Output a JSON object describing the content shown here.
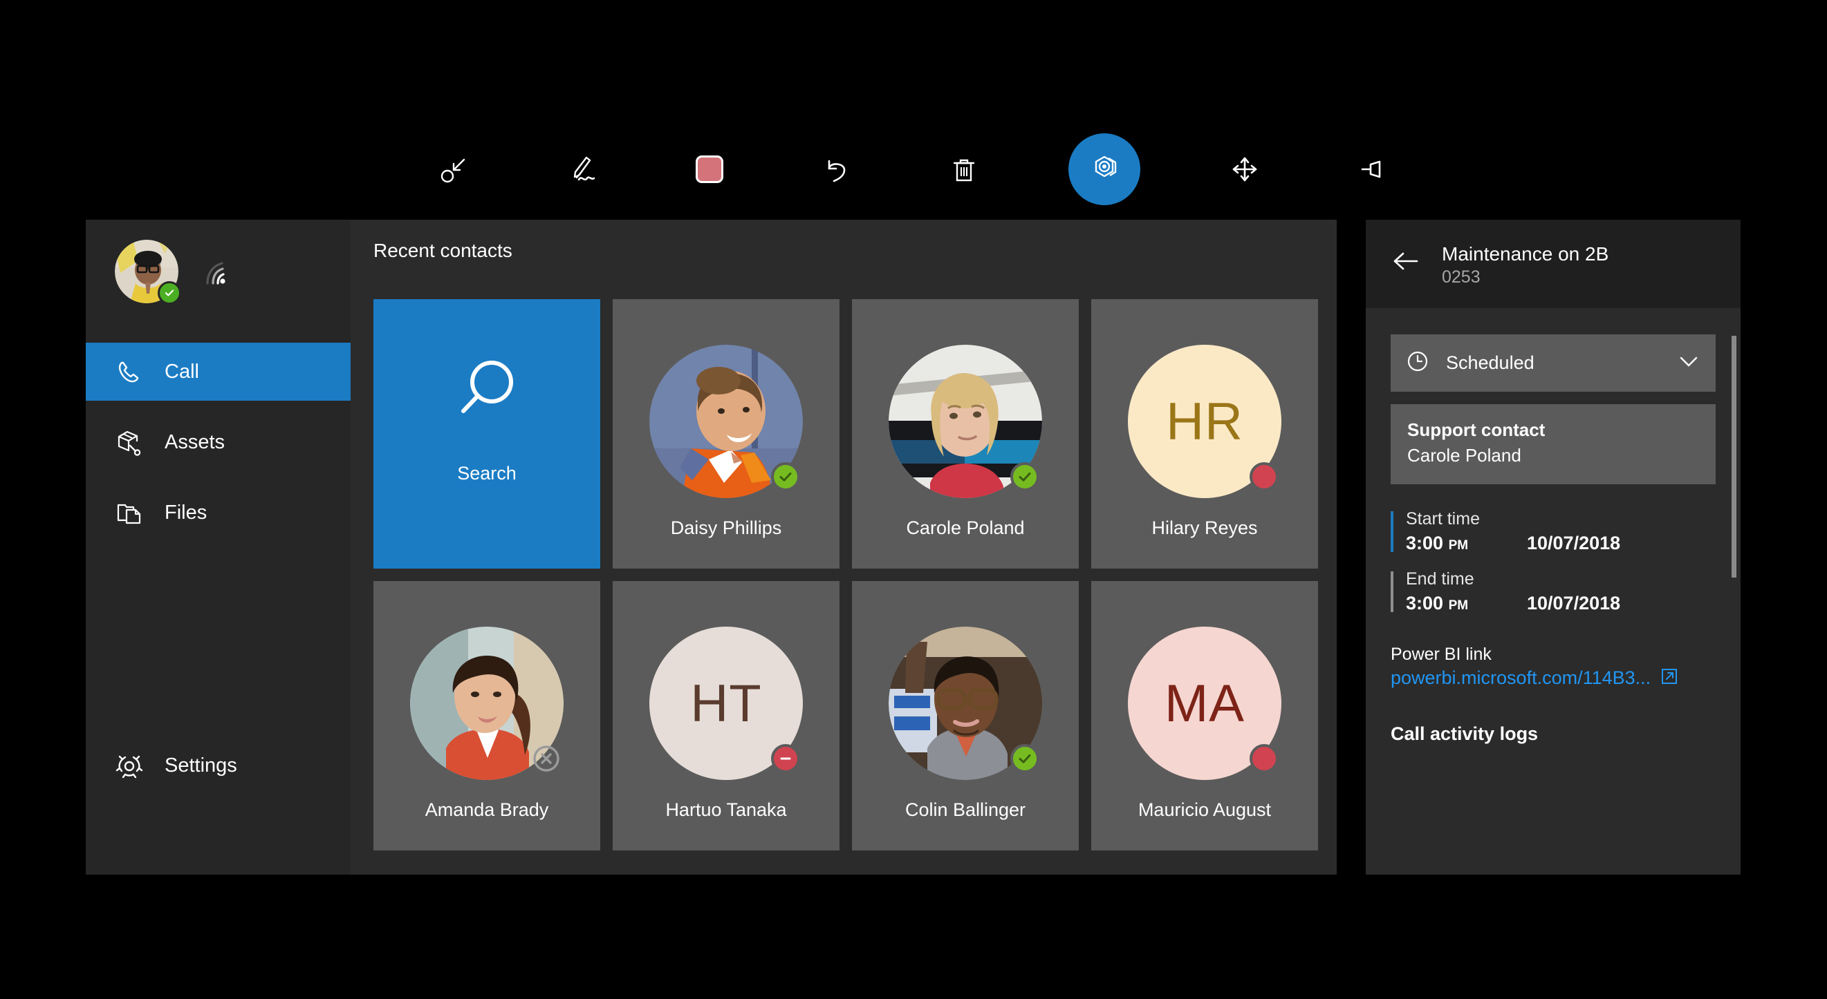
{
  "toolbar": {
    "items": [
      {
        "name": "collapse-icon",
        "label": "Collapse"
      },
      {
        "name": "ink-pen-icon",
        "label": "Ink"
      },
      {
        "name": "color-swatch-icon",
        "label": "Color",
        "color": "#d4737a"
      },
      {
        "name": "undo-icon",
        "label": "Undo"
      },
      {
        "name": "delete-icon",
        "label": "Delete"
      },
      {
        "name": "remote-assist-icon",
        "label": "Remote Assist",
        "color": "#1b7cc4"
      },
      {
        "name": "move-icon",
        "label": "Move"
      },
      {
        "name": "pin-icon",
        "label": "Pin"
      }
    ]
  },
  "sidebar": {
    "user": {
      "presence": "available",
      "signal_icon": "signal-strength-icon"
    },
    "items": [
      {
        "id": "call",
        "label": "Call",
        "icon": "phone-icon",
        "active": true
      },
      {
        "id": "assets",
        "label": "Assets",
        "icon": "assets-box-wrench-icon",
        "active": false
      },
      {
        "id": "files",
        "label": "Files",
        "icon": "files-folder-icon",
        "active": false
      },
      {
        "id": "settings",
        "label": "Settings",
        "icon": "gear-icon",
        "active": false
      }
    ]
  },
  "main": {
    "title": "Recent contacts",
    "search_tile": {
      "label": "Search",
      "icon": "search-icon",
      "color": "#1b7cc4"
    },
    "contacts": [
      {
        "name": "Daisy Phillips",
        "avatar_type": "photo",
        "photo": "daisy",
        "presence": "available"
      },
      {
        "name": "Carole Poland",
        "avatar_type": "photo",
        "photo": "carole",
        "presence": "available"
      },
      {
        "name": "Hilary Reyes",
        "avatar_type": "initials",
        "initials": "HR",
        "bg": "#fbe9c6",
        "fg": "#9a7618",
        "presence": "busy"
      },
      {
        "name": "Amanda Brady",
        "avatar_type": "photo",
        "photo": "amanda",
        "presence": "offline"
      },
      {
        "name": "Hartuo Tanaka",
        "avatar_type": "initials",
        "initials": "HT",
        "bg": "#e6ddd8",
        "fg": "#5a3c2e",
        "presence": "away"
      },
      {
        "name": "Colin Ballinger",
        "avatar_type": "photo",
        "photo": "colin",
        "presence": "available"
      },
      {
        "name": "Mauricio August",
        "avatar_type": "initials",
        "initials": "MA",
        "bg": "#f5d6d0",
        "fg": "#7d2317",
        "presence": "busy"
      }
    ]
  },
  "detail": {
    "back_icon": "back-arrow-icon",
    "title": "Maintenance on 2B",
    "subtitle": "0253",
    "status": {
      "icon": "clock-icon",
      "label": "Scheduled",
      "chevron": "chevron-down-icon"
    },
    "support_contact": {
      "label": "Support contact",
      "value": "Carole Poland"
    },
    "start_time": {
      "label": "Start time",
      "time": "3:00",
      "meridiem": "PM",
      "date": "10/07/2018",
      "accent": "#1b7cc4"
    },
    "end_time": {
      "label": "End time",
      "time": "3:00",
      "meridiem": "PM",
      "date": "10/07/2018",
      "accent": "#8f8f8f"
    },
    "powerbi": {
      "label": "Power BI link",
      "url_text": "powerbi.microsoft.com/114B3...",
      "external_icon": "open-in-new-icon",
      "color": "#2196f3"
    },
    "activity": {
      "label": "Call activity logs"
    }
  }
}
